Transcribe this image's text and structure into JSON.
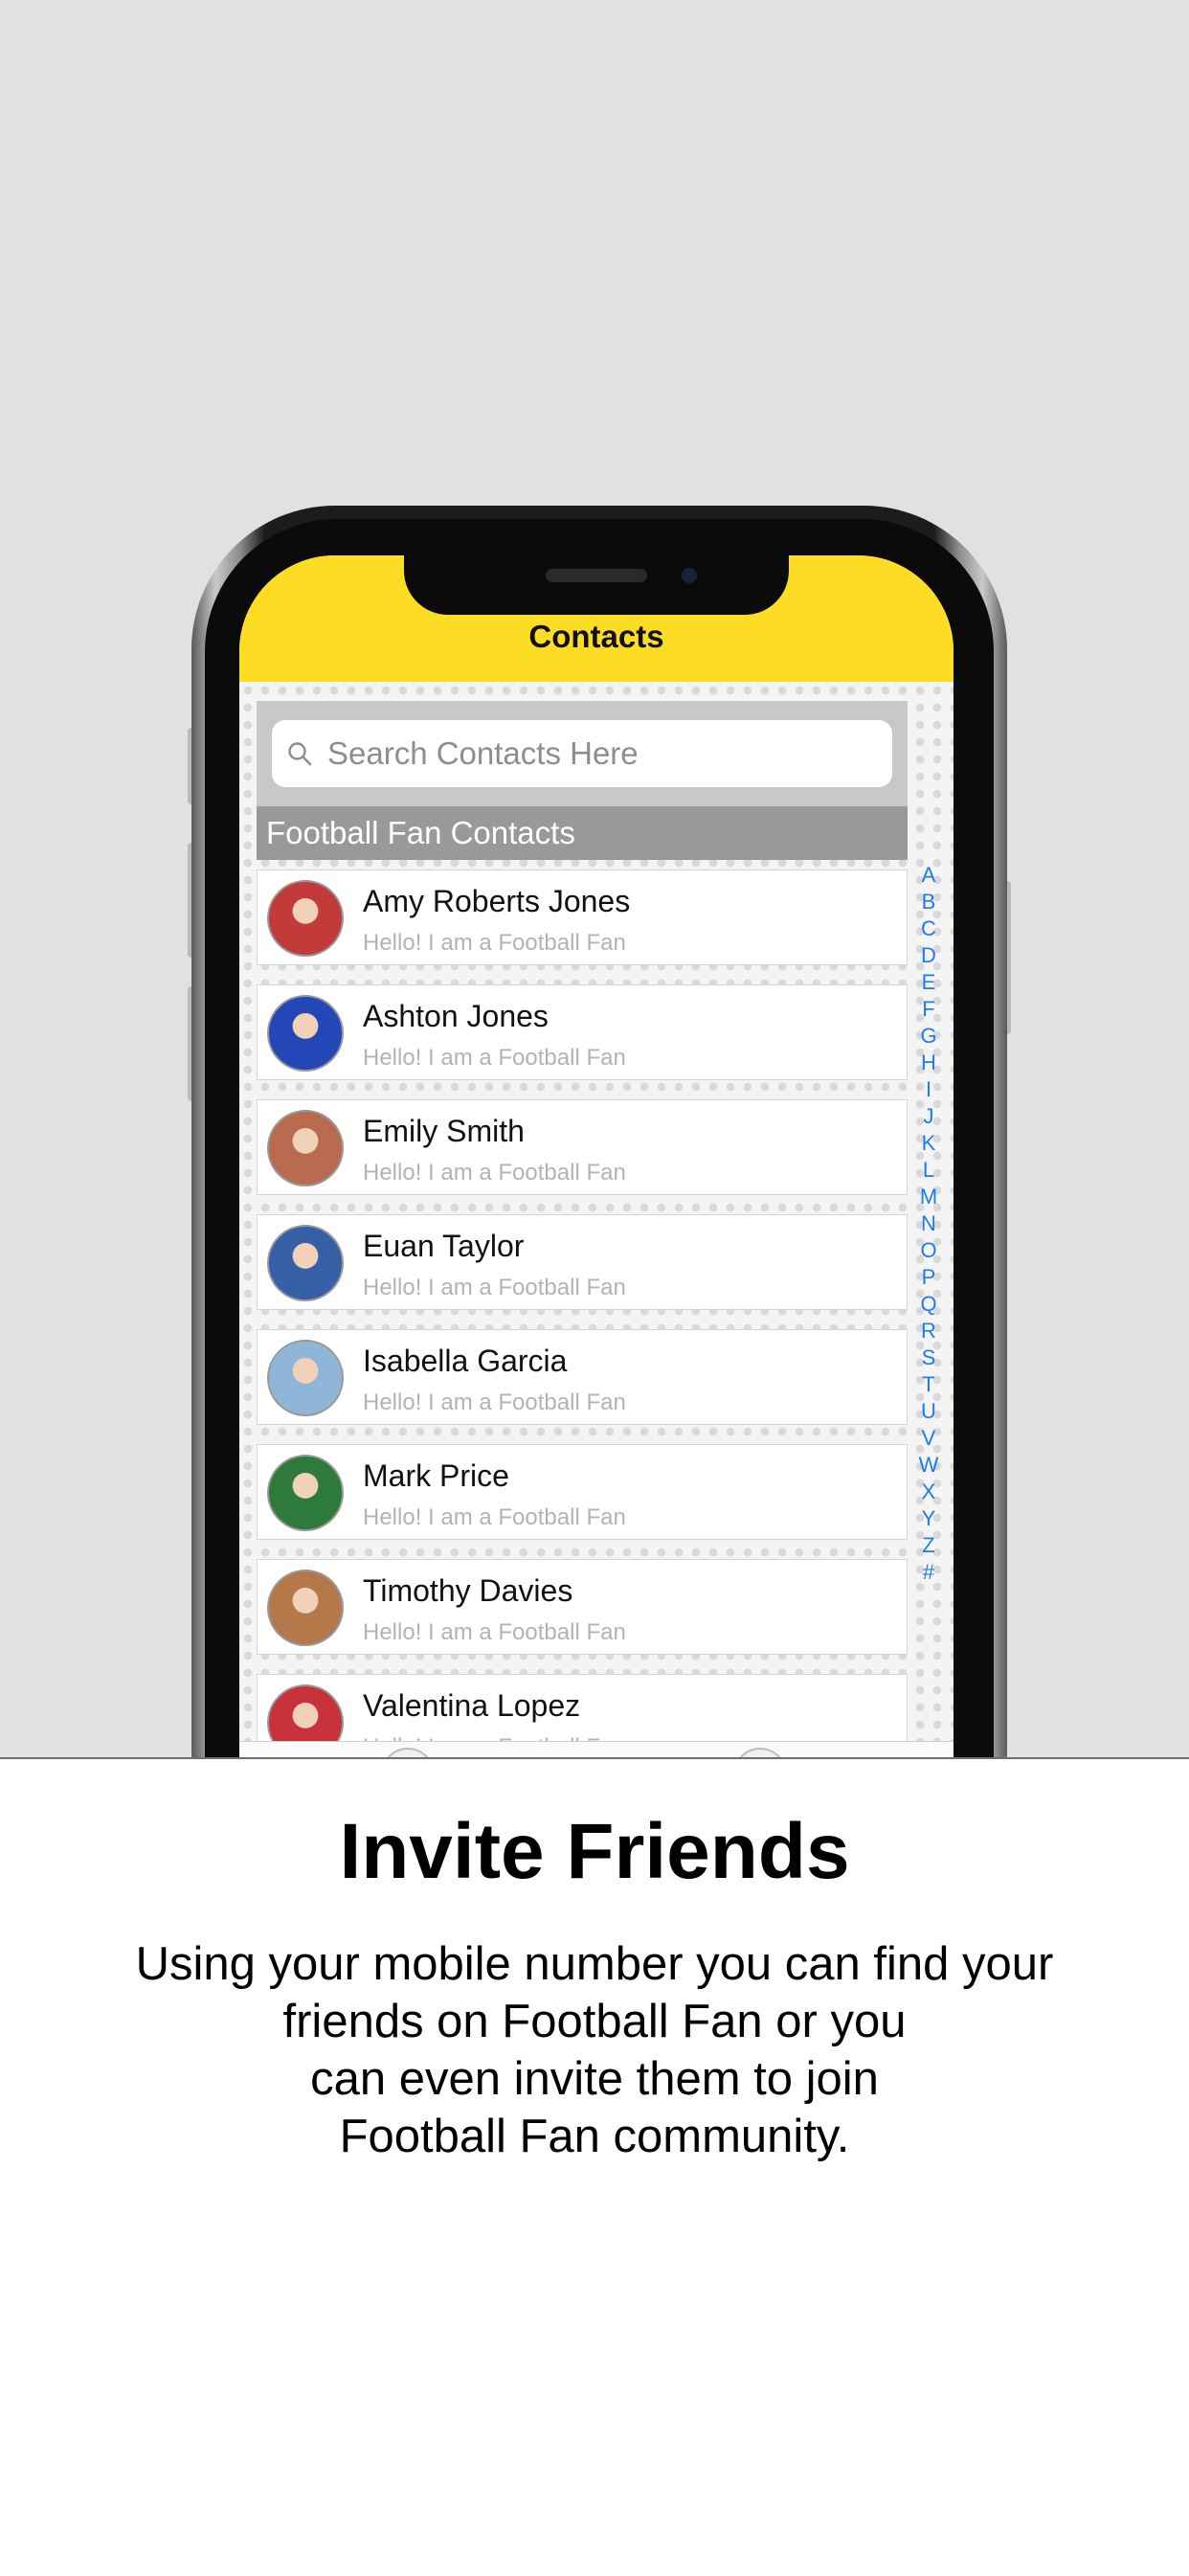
{
  "app": {
    "nav_title": "Contacts",
    "accent_color": "#fddd24",
    "index_color": "#1e7bf2"
  },
  "search": {
    "placeholder": "Search Contacts Here",
    "value": ""
  },
  "section": {
    "title": "Football Fan Contacts"
  },
  "contacts": [
    {
      "name": "Amy Roberts Jones",
      "status": "Hello! I am a Football Fan",
      "avatar_color": "#c23a3a"
    },
    {
      "name": "Ashton Jones",
      "status": "Hello! I am a Football Fan",
      "avatar_color": "#2447b8"
    },
    {
      "name": "Emily Smith",
      "status": "Hello! I am a Football Fan",
      "avatar_color": "#b86b4e"
    },
    {
      "name": "Euan Taylor",
      "status": "Hello! I am a Football Fan",
      "avatar_color": "#3560a8"
    },
    {
      "name": "Isabella Garcia",
      "status": "Hello! I am a Football Fan",
      "avatar_color": "#8fb6d8"
    },
    {
      "name": "Mark Price",
      "status": "Hello! I am a Football Fan",
      "avatar_color": "#2e7a3a"
    },
    {
      "name": "Timothy Davies",
      "status": "Hello! I am a Football Fan",
      "avatar_color": "#b5784a"
    },
    {
      "name": "Valentina Lopez",
      "status": "Hello! I am a Football Fan",
      "avatar_color": "#c8323a"
    }
  ],
  "index_letters": [
    "A",
    "B",
    "C",
    "D",
    "E",
    "F",
    "G",
    "H",
    "I",
    "J",
    "K",
    "L",
    "M",
    "N",
    "O",
    "P",
    "Q",
    "R",
    "S",
    "T",
    "U",
    "V",
    "W",
    "X",
    "Y",
    "Z",
    "#"
  ],
  "promo": {
    "title": "Invite Friends",
    "lines": [
      "Using your mobile number you can find your",
      "friends on Football Fan or you",
      "can even invite them to join",
      "Football Fan community."
    ]
  }
}
